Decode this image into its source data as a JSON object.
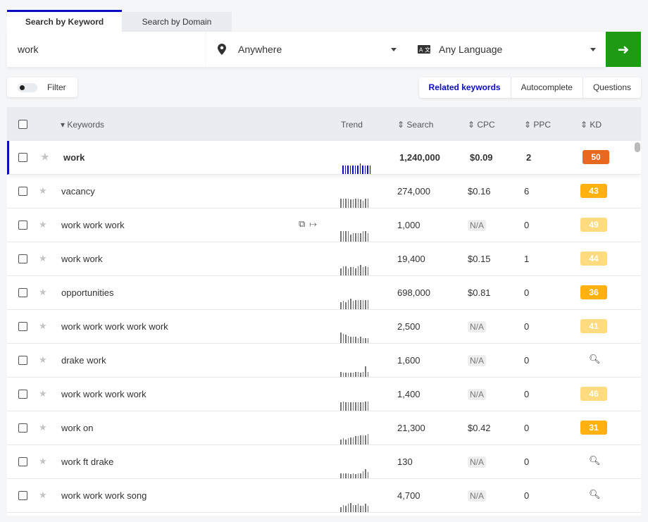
{
  "tabs": [
    {
      "label": "Search by Keyword",
      "active": true
    },
    {
      "label": "Search by Domain",
      "active": false
    }
  ],
  "search": {
    "keyword": "work",
    "location": "Anywhere",
    "language": "Any Language",
    "location_icon": "map-pin-icon",
    "language_icon": "translate-icon",
    "go_icon": "arrow-right-icon",
    "go_color": "#1f9a15"
  },
  "filter": {
    "label": "Filter",
    "enabled": false
  },
  "modes": [
    "Related keywords",
    "Autocomplete",
    "Questions"
  ],
  "columns": {
    "keywords": "Keywords",
    "trend": "Trend",
    "search": "Search",
    "cpc": "CPC",
    "ppc": "PPC",
    "kd": "KD"
  },
  "kd_colors": {
    "high": "#e8681e",
    "medium": "#ffb20f",
    "low": "#ffdb80"
  },
  "rows": [
    {
      "keyword": "work",
      "search": "1,240,000",
      "cpc": "$0.09",
      "ppc": "2",
      "kd": "50",
      "kd_level": "high",
      "trend": [
        8,
        8,
        8,
        8,
        8,
        8,
        8,
        10,
        8,
        8,
        8,
        8
      ]
    },
    {
      "keyword": "vacancy",
      "search": "274,000",
      "cpc": "$0.16",
      "ppc": "6",
      "kd": "43",
      "kd_level": "medium",
      "trend": [
        9,
        9,
        9,
        9,
        8,
        8,
        9,
        9,
        8,
        7,
        9,
        9
      ]
    },
    {
      "keyword": "work work work",
      "search": "1,000",
      "cpc": "N/A",
      "ppc": "0",
      "kd": "49",
      "kd_level": "low",
      "trend": [
        10,
        10,
        10,
        10,
        7,
        8,
        8,
        8,
        8,
        10,
        10,
        8
      ]
    },
    {
      "keyword": "work work",
      "search": "19,400",
      "cpc": "$0.15",
      "ppc": "1",
      "kd": "44",
      "kd_level": "low",
      "trend": [
        7,
        9,
        9,
        7,
        8,
        8,
        7,
        9,
        10,
        8,
        9,
        8
      ]
    },
    {
      "keyword": "opportunities",
      "search": "698,000",
      "cpc": "$0.81",
      "ppc": "0",
      "kd": "36",
      "kd_level": "medium",
      "trend": [
        7,
        8,
        7,
        9,
        10,
        8,
        9,
        9,
        9,
        9,
        9,
        9
      ]
    },
    {
      "keyword": "work work work work work",
      "search": "2,500",
      "cpc": "N/A",
      "ppc": "0",
      "kd": "41",
      "kd_level": "low",
      "trend": [
        10,
        9,
        8,
        7,
        6,
        6,
        6,
        5,
        6,
        5,
        5,
        5
      ]
    },
    {
      "keyword": "drake work",
      "search": "1,600",
      "cpc": "N/A",
      "ppc": "0",
      "kd": null,
      "kd_level": "none",
      "trend": [
        5,
        4,
        4,
        4,
        4,
        4,
        5,
        5,
        4,
        5,
        10,
        5
      ]
    },
    {
      "keyword": "work work work work",
      "search": "1,400",
      "cpc": "N/A",
      "ppc": "0",
      "kd": "46",
      "kd_level": "low",
      "trend": [
        8,
        9,
        8,
        8,
        8,
        8,
        8,
        8,
        8,
        8,
        9,
        9
      ]
    },
    {
      "keyword": "work on",
      "search": "21,300",
      "cpc": "$0.42",
      "ppc": "0",
      "kd": "31",
      "kd_level": "medium",
      "trend": [
        5,
        6,
        5,
        6,
        7,
        7,
        8,
        8,
        9,
        9,
        9,
        10
      ]
    },
    {
      "keyword": "work ft drake",
      "search": "130",
      "cpc": "N/A",
      "ppc": "0",
      "kd": null,
      "kd_level": "none",
      "trend": [
        5,
        5,
        5,
        5,
        4,
        5,
        4,
        5,
        5,
        7,
        9,
        6
      ]
    },
    {
      "keyword": "work work work song",
      "search": "4,700",
      "cpc": "N/A",
      "ppc": "0",
      "kd": null,
      "kd_level": "none",
      "trend": [
        5,
        7,
        6,
        8,
        9,
        7,
        7,
        8,
        6,
        6,
        8,
        6
      ]
    }
  ]
}
